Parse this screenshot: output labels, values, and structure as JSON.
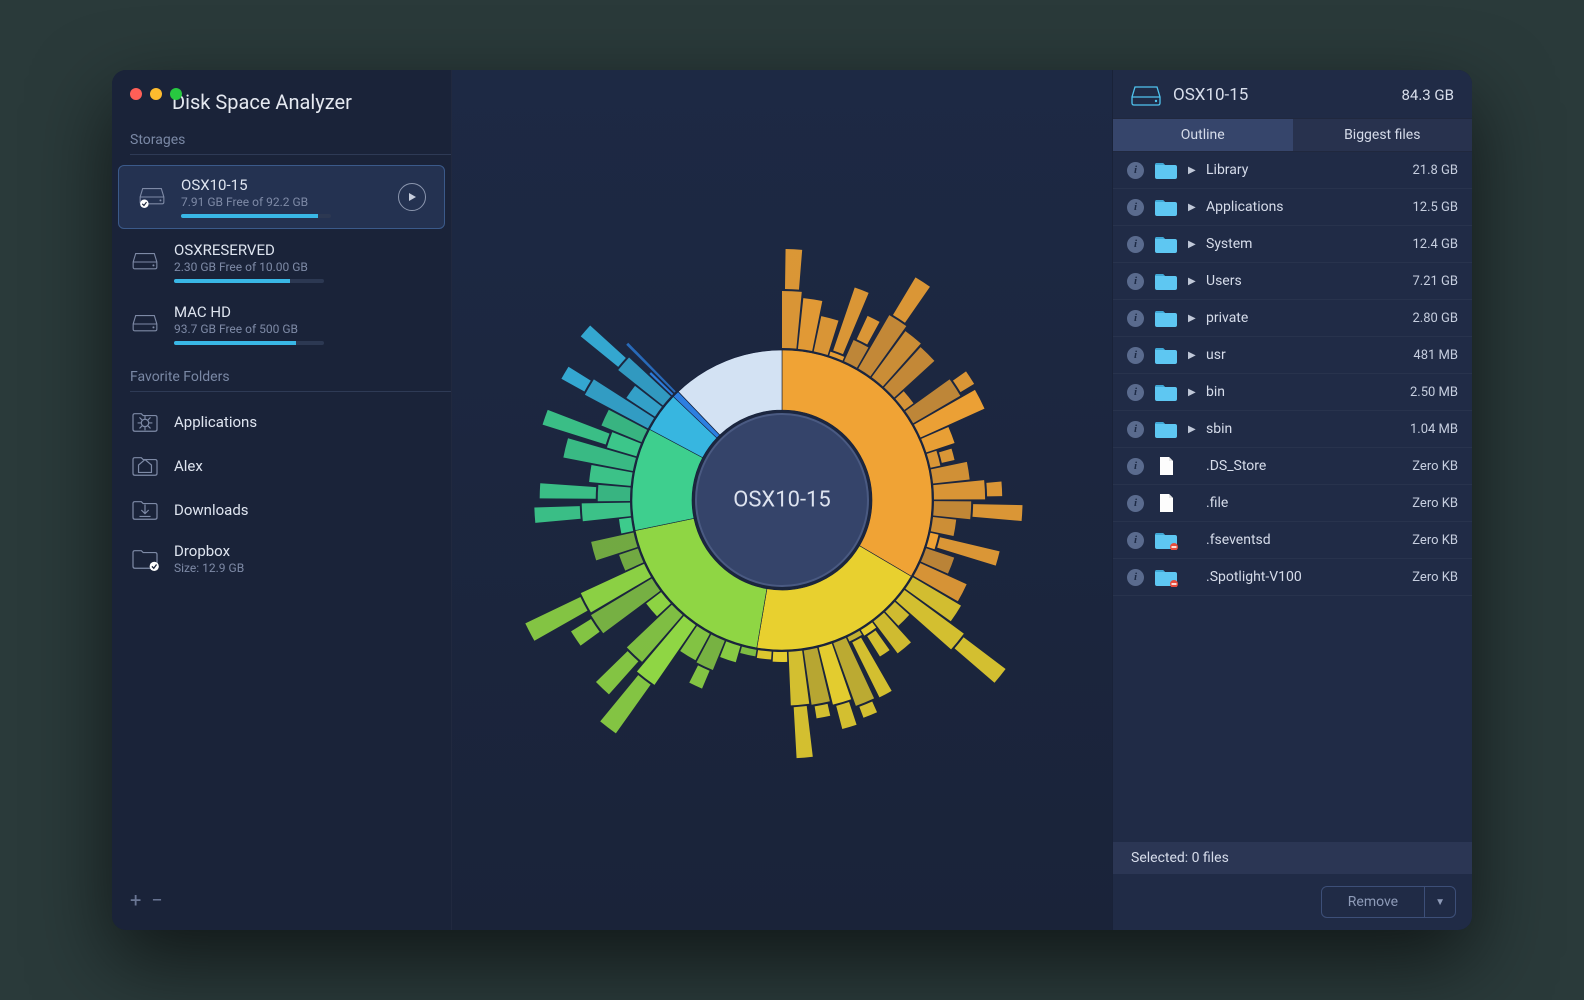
{
  "app_title": "Disk Space Analyzer",
  "sections": {
    "storages": "Storages",
    "favorites": "Favorite Folders"
  },
  "storages": [
    {
      "name": "OSX10-15",
      "sub": "7.91 GB Free of 92.2 GB",
      "used_pct": 91,
      "selected": true,
      "checked": true
    },
    {
      "name": "OSXRESERVED",
      "sub": "2.30 GB Free of 10.00 GB",
      "used_pct": 77,
      "selected": false,
      "checked": false
    },
    {
      "name": "MAC HD",
      "sub": "93.7 GB Free of 500 GB",
      "used_pct": 81,
      "selected": false,
      "checked": false
    }
  ],
  "favorites": [
    {
      "name": "Applications",
      "icon": "app"
    },
    {
      "name": "Alex",
      "icon": "home"
    },
    {
      "name": "Downloads",
      "icon": "download"
    },
    {
      "name": "Dropbox",
      "sub": "Size: 12.9 GB",
      "icon": "folder",
      "checked": true
    }
  ],
  "center_label": "OSX10-15",
  "right_header": {
    "name": "OSX10-15",
    "size": "84.3 GB"
  },
  "tabs": {
    "outline": "Outline",
    "biggest": "Biggest files",
    "active": "outline"
  },
  "outline": [
    {
      "name": "Library",
      "size": "21.8 GB",
      "type": "folder",
      "variant": "up",
      "expandable": true
    },
    {
      "name": "Applications",
      "size": "12.5 GB",
      "type": "folder",
      "variant": "app",
      "expandable": true
    },
    {
      "name": "System",
      "size": "12.4 GB",
      "type": "folder",
      "variant": "sys",
      "expandable": true
    },
    {
      "name": "Users",
      "size": "7.21 GB",
      "type": "folder",
      "variant": "users",
      "expandable": true
    },
    {
      "name": "private",
      "size": "2.80 GB",
      "type": "folder",
      "variant": "plain",
      "expandable": true
    },
    {
      "name": "usr",
      "size": "481 MB",
      "type": "folder",
      "variant": "plain",
      "expandable": true
    },
    {
      "name": "bin",
      "size": "2.50 MB",
      "type": "folder",
      "variant": "plain",
      "expandable": true
    },
    {
      "name": "sbin",
      "size": "1.04 MB",
      "type": "folder",
      "variant": "plain",
      "expandable": true
    },
    {
      "name": ".DS_Store",
      "size": "Zero KB",
      "type": "file",
      "expandable": false
    },
    {
      "name": ".file",
      "size": "Zero KB",
      "type": "file",
      "expandable": false
    },
    {
      "name": ".fseventsd",
      "size": "Zero KB",
      "type": "folder",
      "variant": "restricted",
      "expandable": false
    },
    {
      "name": ".Spotlight-V100",
      "size": "Zero KB",
      "type": "folder",
      "variant": "restricted",
      "expandable": false
    }
  ],
  "selected_bar": "Selected: 0 files",
  "remove_label": "Remove",
  "chart_data": {
    "type": "sunburst",
    "title": "OSX10-15",
    "total_gb": 84.3,
    "series": [
      {
        "name": "Library",
        "value_gb": 21.8,
        "color": "#f0a335"
      },
      {
        "name": "Applications",
        "value_gb": 12.5,
        "color": "#e8d02f"
      },
      {
        "name": "System",
        "value_gb": 12.4,
        "color": "#8fd644"
      },
      {
        "name": "Users",
        "value_gb": 7.21,
        "color": "#3ecf8e"
      },
      {
        "name": "private",
        "value_gb": 2.8,
        "color": "#37b6e0"
      },
      {
        "name": "usr",
        "value_gb": 0.481,
        "color": "#2d7fe0"
      },
      {
        "name": "bin",
        "value_gb": 0.0025,
        "color": "#6462e0"
      },
      {
        "name": "sbin",
        "value_gb": 0.00104,
        "color": "#8a62e0"
      },
      {
        "name": "Free",
        "value_gb": 7.91,
        "color": "#d3e2f3"
      }
    ]
  }
}
